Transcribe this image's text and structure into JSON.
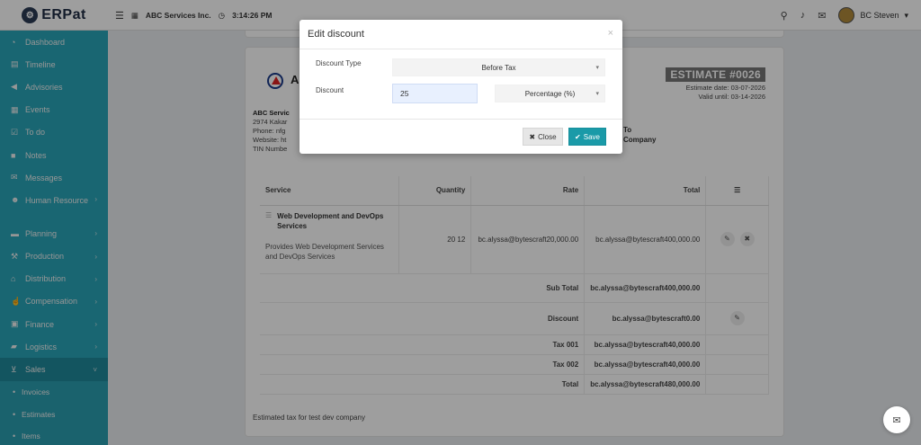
{
  "app": {
    "logo_text": "ERPat"
  },
  "topbar": {
    "company": "ABC Services Inc.",
    "time": "3:14:26 PM",
    "user_name": "BC Steven"
  },
  "sidebar": {
    "items": [
      {
        "label": "Dashboard",
        "icon": "dashboard-icon"
      },
      {
        "label": "Timeline",
        "icon": "timeline-icon"
      },
      {
        "label": "Advisories",
        "icon": "megaphone-icon"
      },
      {
        "label": "Events",
        "icon": "calendar-icon"
      },
      {
        "label": "To do",
        "icon": "checkbox-icon"
      },
      {
        "label": "Notes",
        "icon": "note-icon"
      },
      {
        "label": "Messages",
        "icon": "envelope-icon"
      },
      {
        "label": "Human Resource",
        "icon": "users-icon"
      },
      {
        "label": "Planning",
        "icon": "planning-icon"
      },
      {
        "label": "Production",
        "icon": "production-icon"
      },
      {
        "label": "Distribution",
        "icon": "bank-icon"
      },
      {
        "label": "Compensation",
        "icon": "compensation-icon"
      },
      {
        "label": "Finance",
        "icon": "money-icon"
      },
      {
        "label": "Logistics",
        "icon": "truck-icon"
      },
      {
        "label": "Sales",
        "icon": "cart-icon"
      }
    ],
    "sub_items": [
      "Invoices",
      "Estimates",
      "Items"
    ]
  },
  "estimate": {
    "company_initial": "A",
    "company_lines": [
      "ABC Servic",
      "2974 Kakar",
      "Phone: nfg",
      "Website: ht",
      "TIN Numbe"
    ],
    "badge": "ESTIMATE #0026",
    "estimate_date": "Estimate date: 03-07-2026",
    "valid_until": "Valid until: 03-14-2026",
    "bill_to_lines": [
      "To",
      "Company"
    ],
    "columns": [
      "Service",
      "Quantity",
      "Rate",
      "Total"
    ],
    "menu_icon": "hamburger-icon",
    "row": {
      "title": "Web Development and DevOps Services",
      "description": "Provides Web Development Services and DevOps Services",
      "quantity": "20 12",
      "rate": "bc.alyssa@bytescraft20,000.00",
      "total": "bc.alyssa@bytescraft400,000.00"
    },
    "summary": [
      {
        "label": "Sub Total",
        "value": "bc.alyssa@bytescraft400,000.00"
      },
      {
        "label": "Discount",
        "value": "bc.alyssa@bytescraft0.00"
      },
      {
        "label": "Tax 001",
        "value": "bc.alyssa@bytescraft40,000.00"
      },
      {
        "label": "Tax 002",
        "value": "bc.alyssa@bytescraft40,000.00"
      },
      {
        "label": "Total",
        "value": "bc.alyssa@bytescraft480,000.00"
      }
    ],
    "footer_note": "Estimated tax for test dev company"
  },
  "modal": {
    "title": "Edit discount",
    "discount_type_label": "Discount Type",
    "discount_type_value": "Before Tax",
    "discount_label": "Discount",
    "discount_value": "25",
    "discount_unit": "Percentage (%)",
    "close_label": "Close",
    "save_label": "Save"
  },
  "colors": {
    "sidebar": "#29a5b8",
    "primary": "#1a9aa8"
  }
}
